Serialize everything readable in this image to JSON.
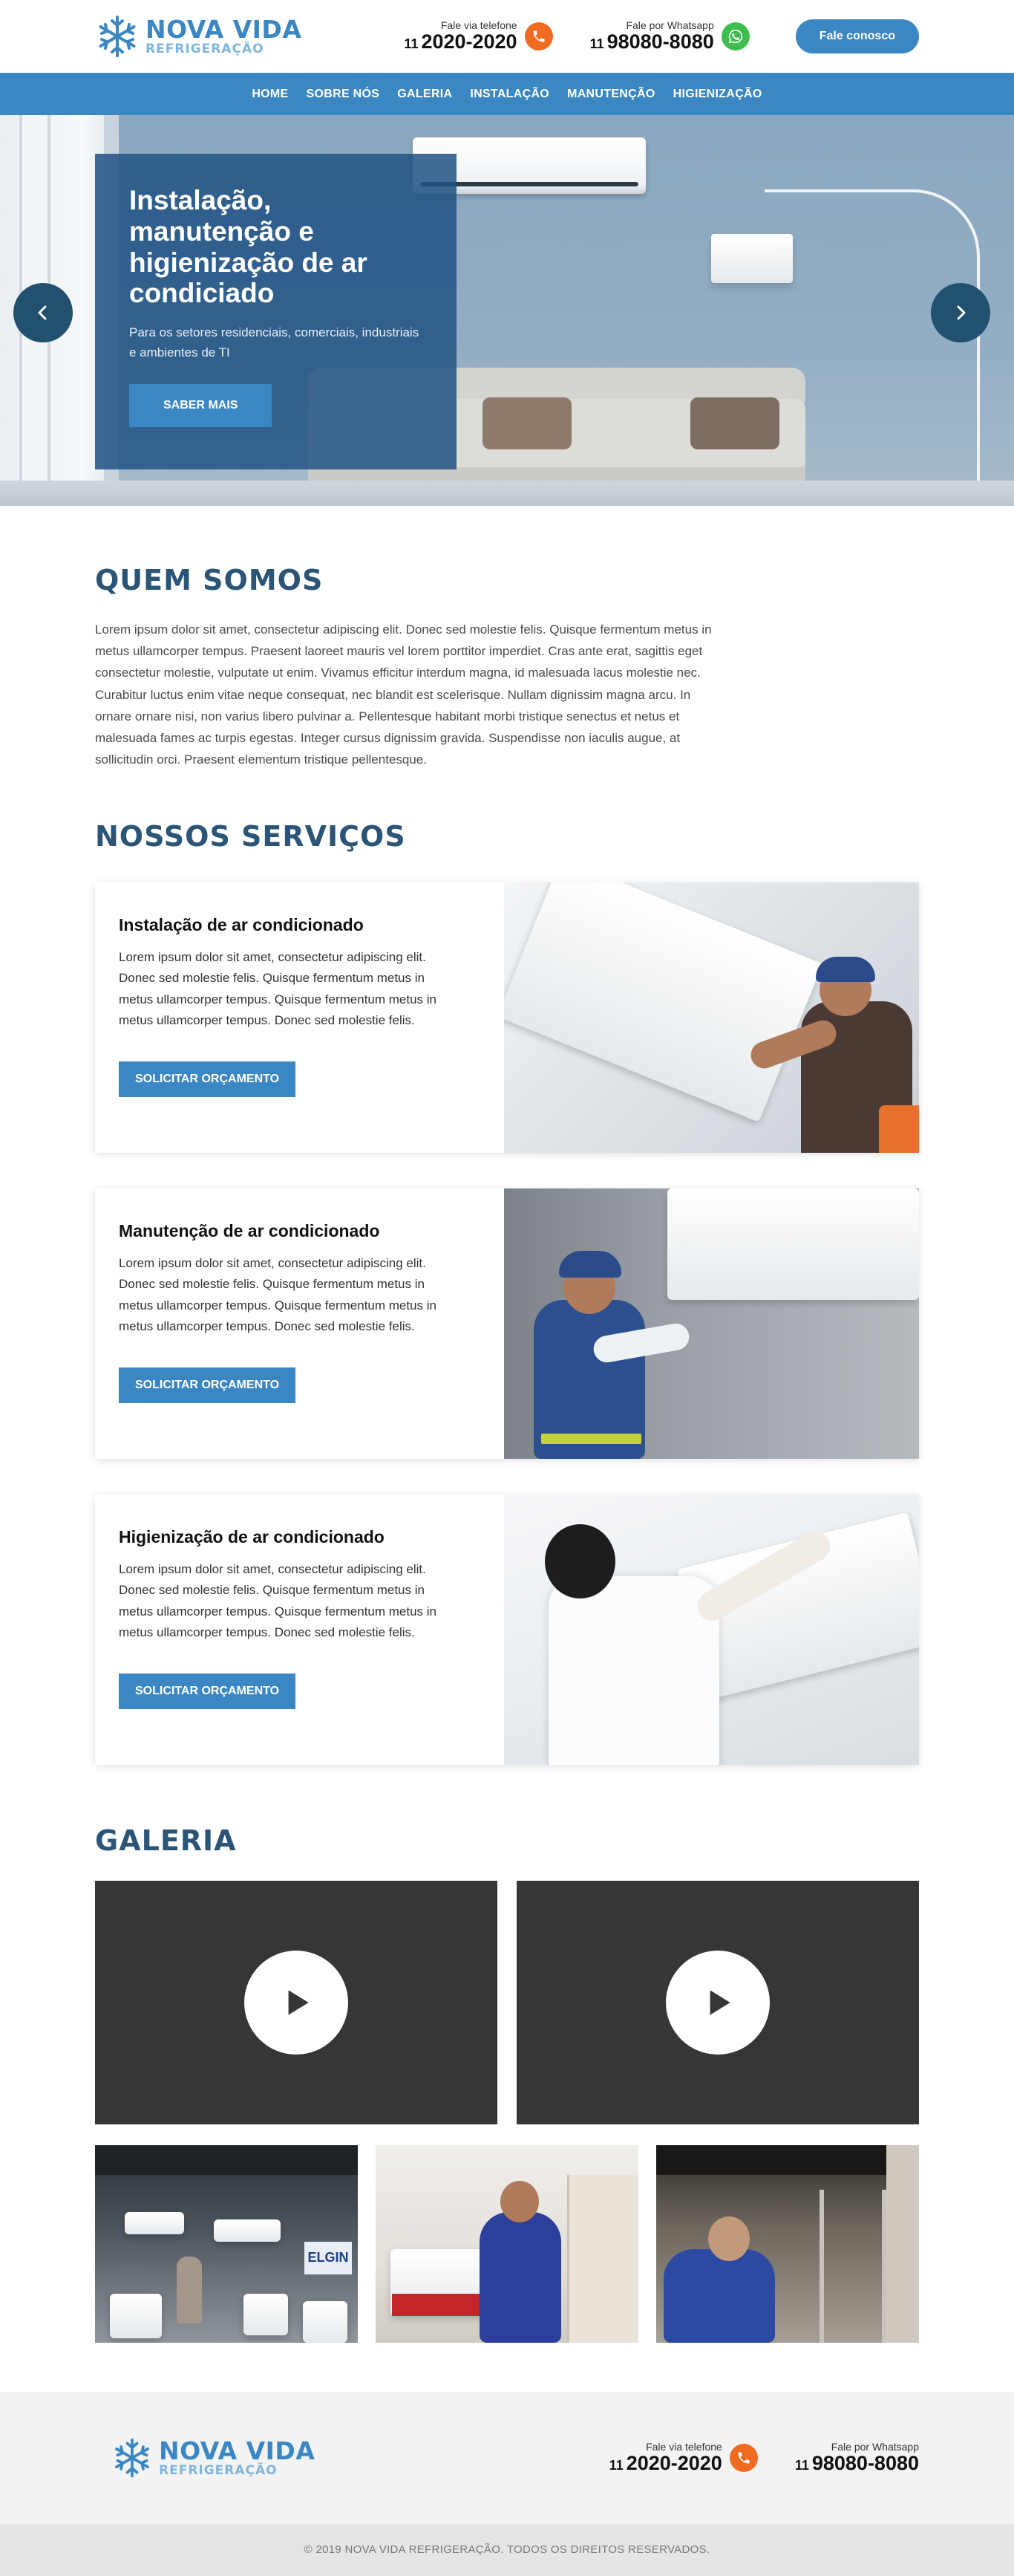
{
  "brand": {
    "name_line1": "NOVA VIDA",
    "name_line2": "REFRIGERAÇÃO"
  },
  "header": {
    "phone_label": "Fale via telefone",
    "phone_ddd": "11",
    "phone_number": "2020-2020",
    "whatsapp_label": "Fale por Whatsapp",
    "whatsapp_ddd": "11",
    "whatsapp_number": "98080-8080",
    "contact_button": "Fale conosco"
  },
  "nav": {
    "items": [
      "HOME",
      "SOBRE NÓS",
      "GALERIA",
      "INSTALAÇÃO",
      "MANUTENÇÃO",
      "HIGIENIZAÇÃO"
    ]
  },
  "hero": {
    "title": "Instalação, manutenção e higienização de ar condiciado",
    "subtitle": "Para os setores residenciais, comerciais, industriais e ambientes de TI",
    "button": "SABER MAIS"
  },
  "quem_somos": {
    "title": "QUEM SOMOS",
    "text": "Lorem ipsum dolor sit amet, consectetur adipiscing elit. Donec sed molestie felis. Quisque fermentum metus in metus ullamcorper tempus. Praesent laoreet mauris vel lorem porttitor imperdiet. Cras ante erat, sagittis eget consectetur molestie, vulputate ut enim. Vivamus efficitur interdum magna, id malesuada lacus molestie nec. Curabitur luctus enim vitae neque consequat, nec blandit est scelerisque. Nullam dignissim magna arcu. In ornare ornare nisi, non varius libero pulvinar a. Pellentesque habitant morbi tristique senectus et netus et malesuada fames ac turpis egestas. Integer cursus dignissim gravida. Suspendisse non iaculis augue, at sollicitudin orci. Praesent elementum tristique pellentesque."
  },
  "servicos": {
    "title": "NOSSOS SERVIÇOS",
    "items": [
      {
        "title": "Instalação de ar condicionado",
        "text": "Lorem ipsum dolor sit amet, consectetur adipiscing elit. Donec sed molestie felis. Quisque fermentum metus in metus ullamcorper tempus. Quisque fermentum metus in metus ullamcorper tempus. Donec sed molestie felis.",
        "button": "SOLICITAR ORÇAMENTO"
      },
      {
        "title": "Manutenção de ar condicionado",
        "text": "Lorem ipsum dolor sit amet, consectetur adipiscing elit. Donec sed molestie felis. Quisque fermentum metus in metus ullamcorper tempus. Quisque fermentum metus in metus ullamcorper tempus. Donec sed molestie felis.",
        "button": "SOLICITAR ORÇAMENTO"
      },
      {
        "title": "Higienização de ar condicionado",
        "text": "Lorem ipsum dolor sit amet, consectetur adipiscing elit. Donec sed molestie felis. Quisque fermentum metus in metus ullamcorper tempus. Quisque fermentum metus in metus ullamcorper tempus. Donec sed molestie felis.",
        "button": "SOLICITAR ORÇAMENTO"
      }
    ]
  },
  "galeria": {
    "title": "GALERIA",
    "thumb_text": "ELGIN"
  },
  "footer": {
    "phone_label": "Fale via telefone",
    "phone_ddd": "11",
    "phone_number": "2020-2020",
    "whatsapp_label": "Fale por Whatsapp",
    "whatsapp_ddd": "11",
    "whatsapp_number": "98080-8080",
    "copyright": "© 2019 NOVA VIDA REFRIGERAÇÃO. TODOS OS DIREITOS RESERVADOS."
  },
  "colors": {
    "primary": "#3b87c4",
    "nav": "#3a87c2",
    "dark_blue": "#2b5577",
    "orange": "#ee6b1f",
    "green": "#3fbd4e"
  },
  "icons": [
    "snowflake-icon",
    "phone-icon",
    "whatsapp-icon",
    "arrow-left-icon",
    "arrow-right-icon",
    "play-icon"
  ]
}
